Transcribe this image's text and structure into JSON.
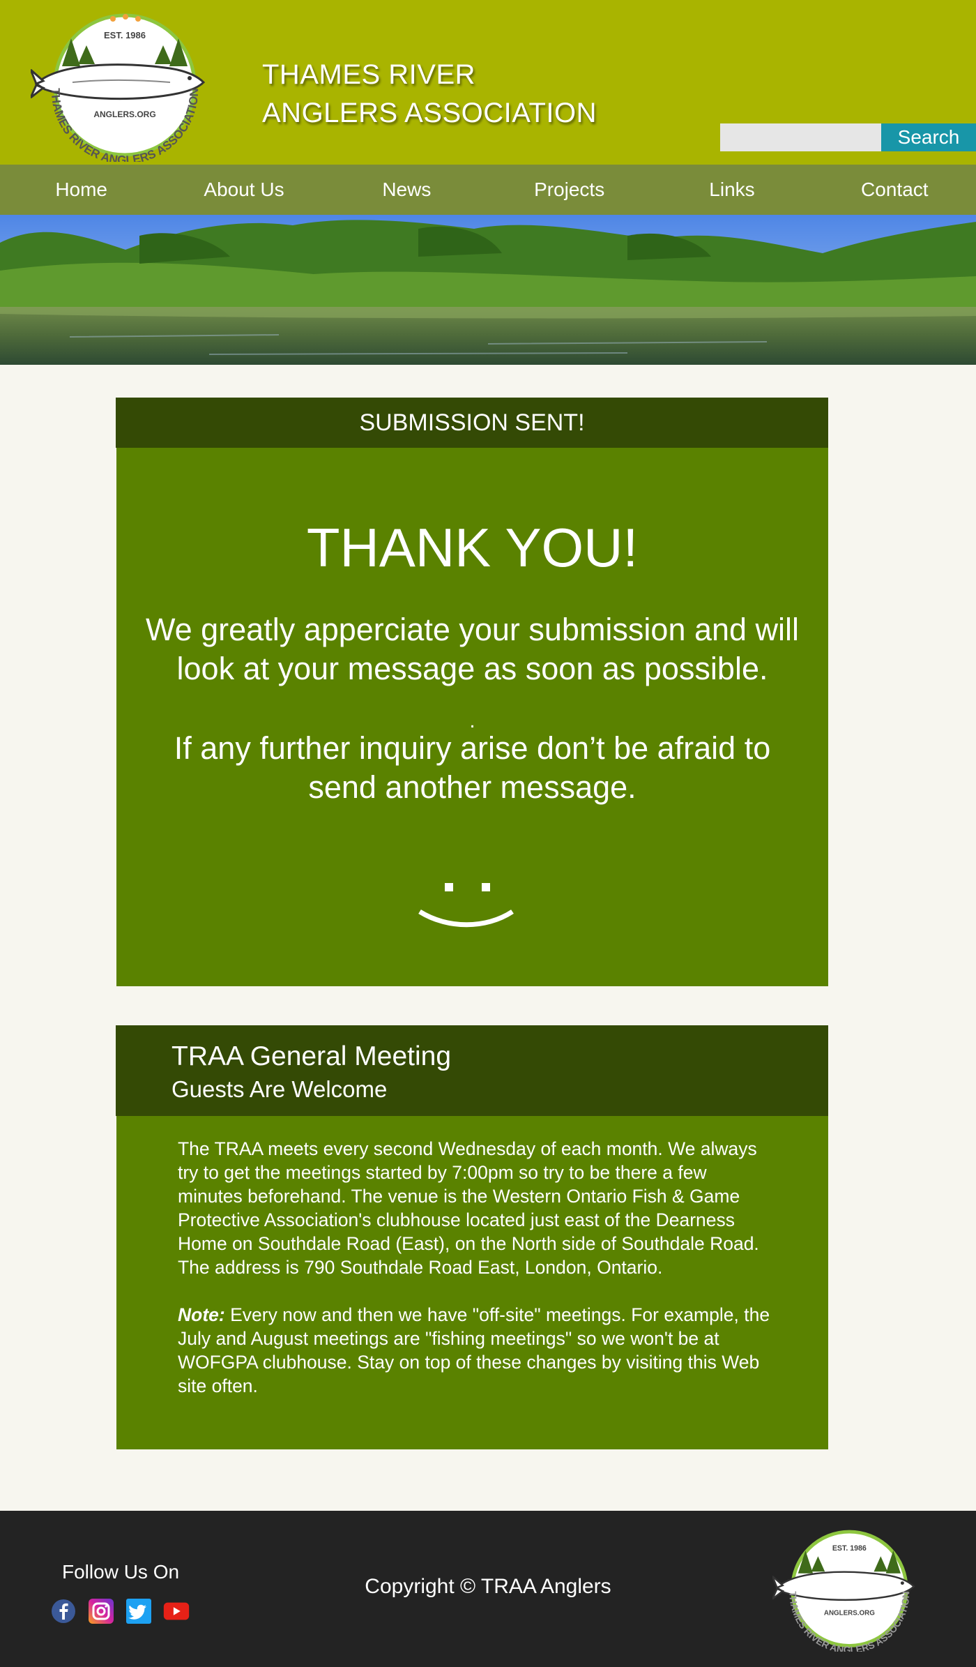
{
  "header": {
    "logo_alt": "THAMES RIVER ANGLERS ASSOCIATION",
    "logo_est": "EST. 1986",
    "logo_url_text": "ANGLERS.ORG",
    "title_line1": "THAMES RIVER",
    "title_line2": "ANGLERS ASSOCIATION",
    "search_placeholder": "",
    "search_label": "Search",
    "colors": {
      "header_bg": "#a9b400",
      "nav_bg": "#7a8c3a",
      "search_button": "#1896a8"
    }
  },
  "nav": {
    "items": [
      {
        "label": "Home"
      },
      {
        "label": "About Us"
      },
      {
        "label": "News"
      },
      {
        "label": "Projects"
      },
      {
        "label": "Links"
      },
      {
        "label": "Contact"
      }
    ]
  },
  "confirmation": {
    "heading": "SUBMISSION SENT!",
    "title": "THANK YOU!",
    "message1": "We greatly apperciate your submission and will look at your message as soon as possible.",
    "separator": ".",
    "message2": "If any further inquiry arise don’t be afraid to send another message.",
    "colors": {
      "head_bg": "#344a05",
      "body_bg": "#5a8200"
    }
  },
  "meeting": {
    "title": "TRAA General Meeting",
    "subtitle": "Guests Are Welcome",
    "paragraph1": "The TRAA meets every second Wednesday of each month. We always try to get the meetings started by 7:00pm so try to be there a few minutes beforehand. The venue is the Western Ontario Fish & Game Protective Association's clubhouse located just east of the Dearness Home on Southdale Road (East), on the North side of Southdale Road. The address is 790 Southdale Road East, London, Ontario.",
    "note_label": "Note:",
    "note_text": " Every now and then we have \"off-site\" meetings. For example, the July and August meetings are \"fishing meetings\" so we won't be at WOFGPA clubhouse. Stay on top of these changes by visiting this Web site often."
  },
  "footer": {
    "follow_label": "Follow Us On",
    "social_icons": [
      "facebook-icon",
      "instagram-icon",
      "twitter-icon",
      "youtube-icon"
    ],
    "copyright": "Copyright © TRAA Anglers",
    "colors": {
      "footer_bg": "#232323"
    }
  }
}
